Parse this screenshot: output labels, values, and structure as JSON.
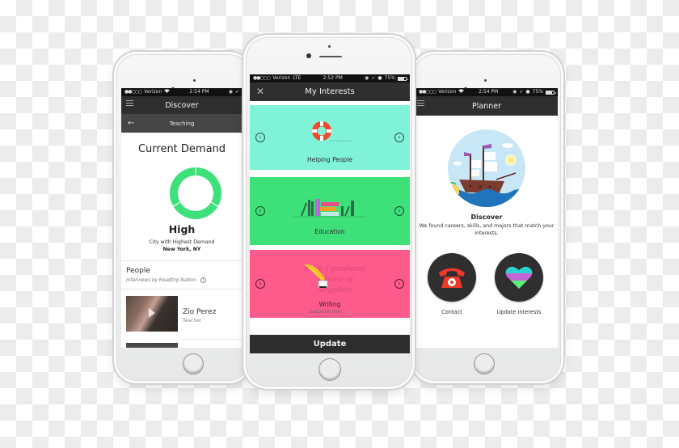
{
  "colors": {
    "status_bar": "#111111",
    "nav_bar": "#2f2f2f",
    "sub_nav": "#454545",
    "demand_green": "#3ee07a",
    "card_helping": "#80f2d7",
    "card_education": "#3ee07a",
    "card_writing": "#ff5a8c",
    "update_button": "#2d2d2d",
    "phone_red": "#f0392b"
  },
  "phones": {
    "left": {
      "status": {
        "carrier": "Verizon",
        "signal": "●●○○○",
        "network_icon": "wifi-icon",
        "time": "2:54 PM"
      },
      "nav": {
        "title": "Discover",
        "left_icon": "hamburger-menu-icon"
      },
      "subnav": {
        "title": "Teaching",
        "left_icon": "back-arrow-icon"
      },
      "demand": {
        "title": "Current Demand",
        "level": "High",
        "gauge_segments_filled": 3,
        "gauge_segments_total": 3,
        "city_label": "City with Highest Demand",
        "city_value": "New York,  NY"
      },
      "people": {
        "title": "People",
        "subtitle": "Interviews by Roadtrip Nation",
        "info_icon": "info-icon",
        "items": [
          {
            "name": "Zio Perez",
            "role": "Teacher"
          }
        ]
      }
    },
    "middle": {
      "status": {
        "carrier": "Verizon",
        "signal": "●●○○○",
        "network": "LTE",
        "time": "2:52 PM",
        "battery": "75%"
      },
      "nav": {
        "title": "My Interests",
        "left_icon": "close-icon"
      },
      "cards": [
        {
          "label": "Helping People",
          "icon": "life-ring-icon",
          "color": "#80f2d7"
        },
        {
          "label": "Education",
          "icon": "books-icon",
          "color": "#3ee07a"
        },
        {
          "label": "Writing",
          "icon": "quill-icon",
          "color": "#ff5a8c",
          "background_text": [
            "while I pondered",
            "volume of forgotten"
          ]
        }
      ],
      "surprise_label": "Surprise me!",
      "update_label": "Update"
    },
    "right": {
      "status": {
        "carrier": "Verizon",
        "signal": "●●○○○",
        "network_icon": "wifi-icon",
        "time": "2:54 PM",
        "battery": "75%"
      },
      "nav": {
        "title": "Planner",
        "left_icon": "hamburger-menu-icon"
      },
      "discover": {
        "title": "Discover",
        "text": "We found careers, skills, and majors that match your interests."
      },
      "actions": [
        {
          "label": "Contact",
          "icon": "telephone-icon"
        },
        {
          "label": "Update Interests",
          "icon": "heart-icon"
        }
      ]
    }
  }
}
